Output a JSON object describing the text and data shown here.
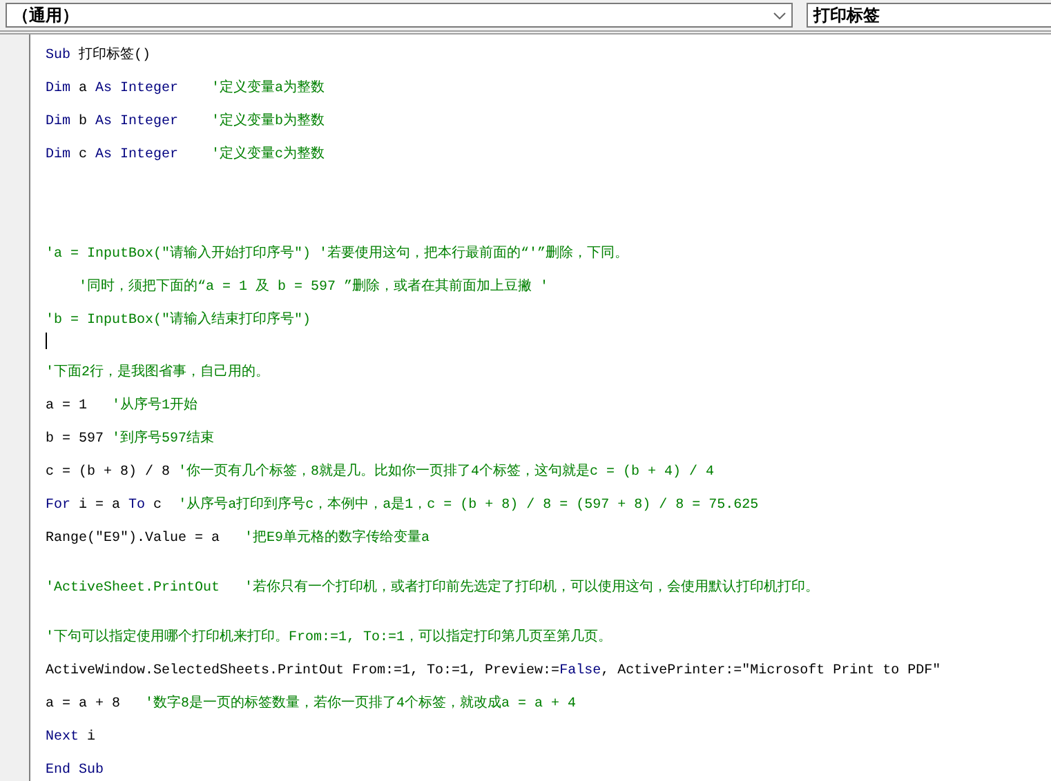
{
  "object_dropdown": {
    "value": "（通用）"
  },
  "procedure_dropdown": {
    "value": "打印标签"
  },
  "code_lines": [
    {
      "kind": "code",
      "tokens": [
        {
          "kind": "keyword",
          "text": "Sub"
        },
        {
          "kind": "plain",
          "text": " 打印标签()"
        }
      ]
    },
    {
      "kind": "code",
      "tokens": [
        {
          "kind": "keyword",
          "text": "Dim"
        },
        {
          "kind": "plain",
          "text": " a "
        },
        {
          "kind": "keyword",
          "text": "As Integer    "
        },
        {
          "kind": "comment",
          "text": "'定义变量a为整数"
        }
      ]
    },
    {
      "kind": "code",
      "tokens": [
        {
          "kind": "keyword",
          "text": "Dim"
        },
        {
          "kind": "plain",
          "text": " b "
        },
        {
          "kind": "keyword",
          "text": "As Integer    "
        },
        {
          "kind": "comment",
          "text": "'定义变量b为整数"
        }
      ]
    },
    {
      "kind": "code",
      "tokens": [
        {
          "kind": "keyword",
          "text": "Dim"
        },
        {
          "kind": "plain",
          "text": " c "
        },
        {
          "kind": "keyword",
          "text": "As Integer    "
        },
        {
          "kind": "comment",
          "text": "'定义变量c为整数"
        }
      ]
    },
    {
      "kind": "blank"
    },
    {
      "kind": "blank"
    },
    {
      "kind": "blank"
    },
    {
      "kind": "blank"
    },
    {
      "kind": "code",
      "tokens": [
        {
          "kind": "comment",
          "text": "'a = InputBox(\"请输入开始打印序号\") '若要使用这句，把本行最前面的“'”删除，下同。"
        }
      ]
    },
    {
      "kind": "code",
      "indented": true,
      "tokens": [
        {
          "kind": "comment",
          "text": "'同时，须把下面的“a = 1 及 b = 597 ”删除，或者在其前面加上豆撇 '"
        }
      ]
    },
    {
      "kind": "code",
      "tokens": [
        {
          "kind": "comment",
          "text": "'b = InputBox(\"请输入结束打印序号\")"
        }
      ]
    },
    {
      "kind": "caret"
    },
    {
      "kind": "code",
      "tokens": [
        {
          "kind": "comment",
          "text": "'下面2行，是我图省事，自己用的。"
        }
      ]
    },
    {
      "kind": "code",
      "tokens": [
        {
          "kind": "plain",
          "text": "a = 1   "
        },
        {
          "kind": "comment",
          "text": "'从序号1开始"
        }
      ]
    },
    {
      "kind": "code",
      "tokens": [
        {
          "kind": "plain",
          "text": "b = 597 "
        },
        {
          "kind": "comment",
          "text": "'到序号597结束"
        }
      ]
    },
    {
      "kind": "code",
      "tokens": [
        {
          "kind": "plain",
          "text": "c = (b + 8) / 8 "
        },
        {
          "kind": "comment",
          "text": "'你一页有几个标签，8就是几。比如你一页排了4个标签，这句就是c = (b + 4) / 4"
        }
      ]
    },
    {
      "kind": "code",
      "tokens": [
        {
          "kind": "keyword",
          "text": "For"
        },
        {
          "kind": "plain",
          "text": " i = a "
        },
        {
          "kind": "keyword",
          "text": "To"
        },
        {
          "kind": "plain",
          "text": " c  "
        },
        {
          "kind": "comment",
          "text": "'从序号a打印到序号c，本例中，a是1，c = (b + 8) / 8 = (597 + 8) / 8 = 75.625"
        }
      ]
    },
    {
      "kind": "code",
      "tokens": [
        {
          "kind": "plain",
          "text": "Range(\"E9\").Value = a   "
        },
        {
          "kind": "comment",
          "text": "'把E9单元格的数字传给变量a"
        }
      ]
    },
    {
      "kind": "blank"
    },
    {
      "kind": "code",
      "tokens": [
        {
          "kind": "comment",
          "text": "'ActiveSheet.PrintOut   '若你只有一个打印机，或者打印前先选定了打印机，可以使用这句，会使用默认打印机打印。"
        }
      ]
    },
    {
      "kind": "blank"
    },
    {
      "kind": "code",
      "tokens": [
        {
          "kind": "comment",
          "text": "'下句可以指定使用哪个打印机来打印。From:=1, To:=1，可以指定打印第几页至第几页。"
        }
      ]
    },
    {
      "kind": "code",
      "tokens": [
        {
          "kind": "plain",
          "text": "ActiveWindow.SelectedSheets.PrintOut From:=1, To:=1, Preview:="
        },
        {
          "kind": "keyword",
          "text": "False"
        },
        {
          "kind": "plain",
          "text": ", ActivePrinter:=\"Microsoft Print to PDF\""
        }
      ]
    },
    {
      "kind": "code",
      "tokens": [
        {
          "kind": "plain",
          "text": "a = a + 8   "
        },
        {
          "kind": "comment",
          "text": "'数字8是一页的标签数量，若你一页排了4个标签，就改成a = a + 4"
        }
      ]
    },
    {
      "kind": "code",
      "tokens": [
        {
          "kind": "keyword",
          "text": "Next"
        },
        {
          "kind": "plain",
          "text": " i"
        }
      ]
    },
    {
      "kind": "code",
      "tokens": [
        {
          "kind": "keyword",
          "text": "End Sub"
        }
      ]
    }
  ]
}
